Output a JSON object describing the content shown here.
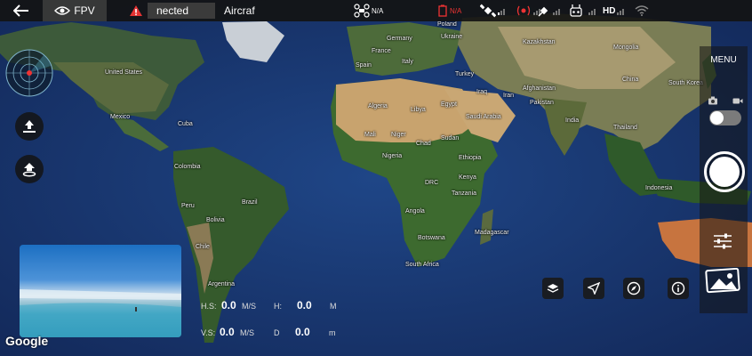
{
  "topbar": {
    "mode_label": "FPV",
    "connection_status": "nected",
    "aircraft_label": "Aircraf",
    "drone_signal": "N/A",
    "warning_value": "N/A",
    "video_quality": "HD"
  },
  "map": {
    "labels": [
      "Poland",
      "Ukraine",
      "Germany",
      "Kazakhstan",
      "Mongolia",
      "France",
      "Spain",
      "Italy",
      "Turkey",
      "China",
      "South Korea",
      "Iraq",
      "Iran",
      "Afghanistan",
      "Pakistan",
      "India",
      "Thailand",
      "Algeria",
      "Libya",
      "Egypt",
      "Saudi Arabia",
      "Mali",
      "Niger",
      "Chad",
      "Sudan",
      "Nigeria",
      "Ethiopia",
      "DRC",
      "Kenya",
      "Tanzania",
      "Angola",
      "Botswana",
      "Madagascar",
      "South Africa",
      "Indonesia",
      "United States",
      "Mexico",
      "Cuba",
      "Colombia",
      "Peru",
      "Bolivia",
      "Brazil",
      "Chile",
      "Argentina"
    ],
    "attribution": "Google"
  },
  "telemetry": {
    "hs_label": "H.S:",
    "hs_value": "0.0",
    "hs_unit": "M/S",
    "h_label": "H:",
    "h_value": "0.0",
    "h_unit": "M",
    "vs_label": "V.S:",
    "vs_value": "0.0",
    "vs_unit": "M/S",
    "d_label": "D",
    "d_value": "0.0",
    "d_unit": "m"
  },
  "right_panel": {
    "menu_label": "MENU"
  },
  "colors": {
    "topbar_bg": "#141414",
    "warning": "#e33333",
    "ocean": "#1b3b73",
    "land_green": "#3c5a2e",
    "desert": "#c9a774"
  }
}
